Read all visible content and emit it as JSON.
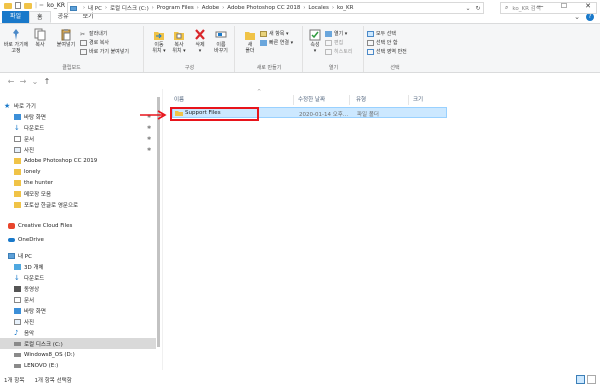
{
  "titlebar": {
    "sep": "| =",
    "title": "ko_KR",
    "min": "—",
    "max": "☐",
    "close": "✕"
  },
  "tabs": {
    "file": "파일",
    "home": "홈",
    "share": "공유",
    "view": "보기",
    "expand": "⌄"
  },
  "ribbon": {
    "pin_label": "바로 가기에\n고정",
    "copy_label": "복사",
    "paste_label": "붙여넣기",
    "cut_label": "잘라내기",
    "copy_path_label": "경로 복사",
    "paste_shortcut_label": "바로 가기 붙여넣기",
    "clipboard_group": "클립보드",
    "move_label": "이동\n위치 ▾",
    "copyto_label": "복사\n위치 ▾",
    "delete_label": "삭제\n▾",
    "rename_label": "이름\n바꾸기",
    "organize_group": "구성",
    "newfolder_label": "새\n폴더",
    "newitem_label": "새 항목 ▾",
    "easyaccess_label": "빠른 연결 ▾",
    "new_group": "새로 만들기",
    "properties_label": "속성\n▾",
    "open_label": "열기 ▾",
    "edit_label": "편집",
    "history_label": "히스토리",
    "open_group": "열기",
    "selectall_label": "모두 선택",
    "selectnone_label": "선택 안 함",
    "invert_label": "선택 영역 반전",
    "select_group": "선택"
  },
  "address": {
    "crumbs": [
      "내 PC",
      "로컬 디스크 (C:)",
      "Program Files",
      "Adobe",
      "Adobe Photoshop CC 2018",
      "Locales",
      "ko_KR"
    ],
    "sep": "›",
    "dropdown": "⌄",
    "refresh": "↻",
    "search_placeholder": "ko_KR 검색"
  },
  "nav": {
    "back": "←",
    "forward": "→",
    "recent": "⌄",
    "up": "↑",
    "quick_access": "바로 가기",
    "items": [
      {
        "label": "바탕 화면",
        "pinned": true
      },
      {
        "label": "다운로드",
        "pinned": true
      },
      {
        "label": "문서",
        "pinned": true
      },
      {
        "label": "사진",
        "pinned": true
      },
      {
        "label": "Adobe Photoshop CC 2019",
        "pinned": false
      },
      {
        "label": "lonely",
        "pinned": false
      },
      {
        "label": "the hunter",
        "pinned": false
      },
      {
        "label": "메모장 모음",
        "pinned": false
      },
      {
        "label": "포토샵 한글로 영문으로",
        "pinned": false
      }
    ],
    "creative_cloud": "Creative Cloud Files",
    "onedrive": "OneDrive",
    "this_pc": "내 PC",
    "pc_items": [
      "3D 개체",
      "다운로드",
      "동영상",
      "문서",
      "바탕 화면",
      "사진",
      "음악",
      "로컬 디스크 (C:)",
      "Windows8_OS (D:)",
      "LENOVO (E:)"
    ],
    "pin_glyph": "✱"
  },
  "columns": {
    "name": "이름",
    "date": "수정한 날짜",
    "type": "유형",
    "size": "크기",
    "sort_caret": "^"
  },
  "files": [
    {
      "name": "Support Files",
      "date": "2020-01-14 오후...",
      "type": "파일 폴더",
      "size": ""
    }
  ],
  "status": {
    "count": "1개 항목",
    "selected": "1개 항목 선택함"
  },
  "colors": {
    "accent": "#1979ca",
    "selection": "#cce8ff",
    "highlight": "#e8141b",
    "folder": "#f0c347"
  }
}
